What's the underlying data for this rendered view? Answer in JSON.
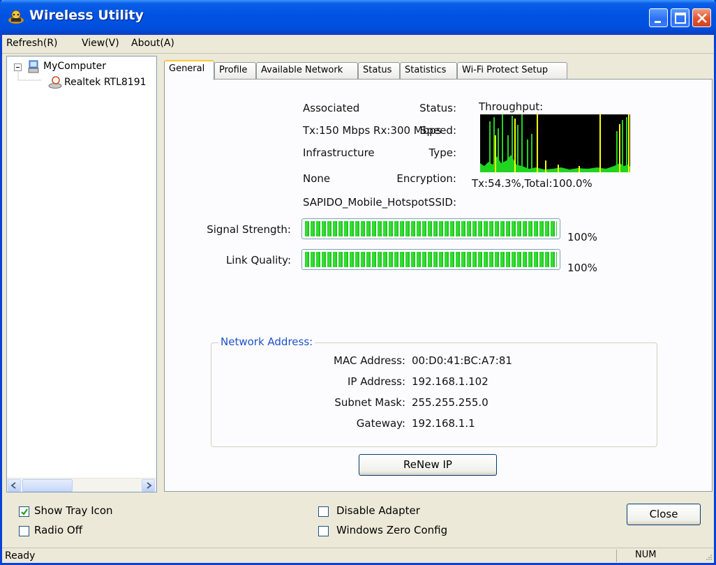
{
  "window": {
    "title": "Wireless Utility",
    "controls": [
      "minimize-icon",
      "maximize-icon",
      "close-icon"
    ]
  },
  "menu": [
    {
      "label": "Refresh(R)"
    },
    {
      "label": "View(V)"
    },
    {
      "label": "About(A)"
    }
  ],
  "tree": {
    "root": "MyComputer",
    "child": "Realtek RTL8191"
  },
  "tabs": [
    "General",
    "Profile",
    "Available Network",
    "Status",
    "Statistics",
    "Wi-Fi Protect Setup"
  ],
  "general": {
    "status_label": "Status:",
    "status_value": "Associated",
    "speed_label": "Speed:",
    "speed_value": "Tx:150 Mbps Rx:300 Mbps",
    "type_label": "Type:",
    "type_value": "Infrastructure",
    "encryption_label": "Encryption:",
    "encryption_value": "None",
    "ssid_label": "SSID:",
    "ssid_value": "SAPIDO_Mobile_Hotspot",
    "throughput_label": "Throughput:",
    "throughput_summary": "Tx:54.3%,Total:100.0%",
    "signal_label": "Signal Strength:",
    "signal_percent": 100,
    "signal_text": "100%",
    "link_label": "Link Quality:",
    "link_percent": 100,
    "link_text": "100%"
  },
  "network_address": {
    "title": "Network Address:",
    "mac_label": "MAC Address:",
    "mac_value": "00:D0:41:BC:A7:81",
    "ip_label": "IP Address:",
    "ip_value": "192.168.1.102",
    "mask_label": "Subnet Mask:",
    "mask_value": "255.255.255.0",
    "gateway_label": "Gateway:",
    "gateway_value": "192.168.1.1"
  },
  "buttons": {
    "renew": "ReNew IP",
    "close": "Close"
  },
  "options": {
    "show_tray_icon": {
      "label": "Show Tray Icon",
      "checked": true
    },
    "radio_off": {
      "label": "Radio Off",
      "checked": false
    },
    "disable_adapter": {
      "label": "Disable Adapter",
      "checked": false
    },
    "windows_zero_config": {
      "label": "Windows Zero Config",
      "checked": false
    }
  },
  "statusbar": {
    "text": "Ready",
    "num": "NUM"
  },
  "colors": {
    "titlebar": "#0053e2",
    "meter_green": "#2bd12b",
    "graph_green": "#22d422",
    "graph_yellow": "#ffff00",
    "group_title": "#1d50c8"
  }
}
